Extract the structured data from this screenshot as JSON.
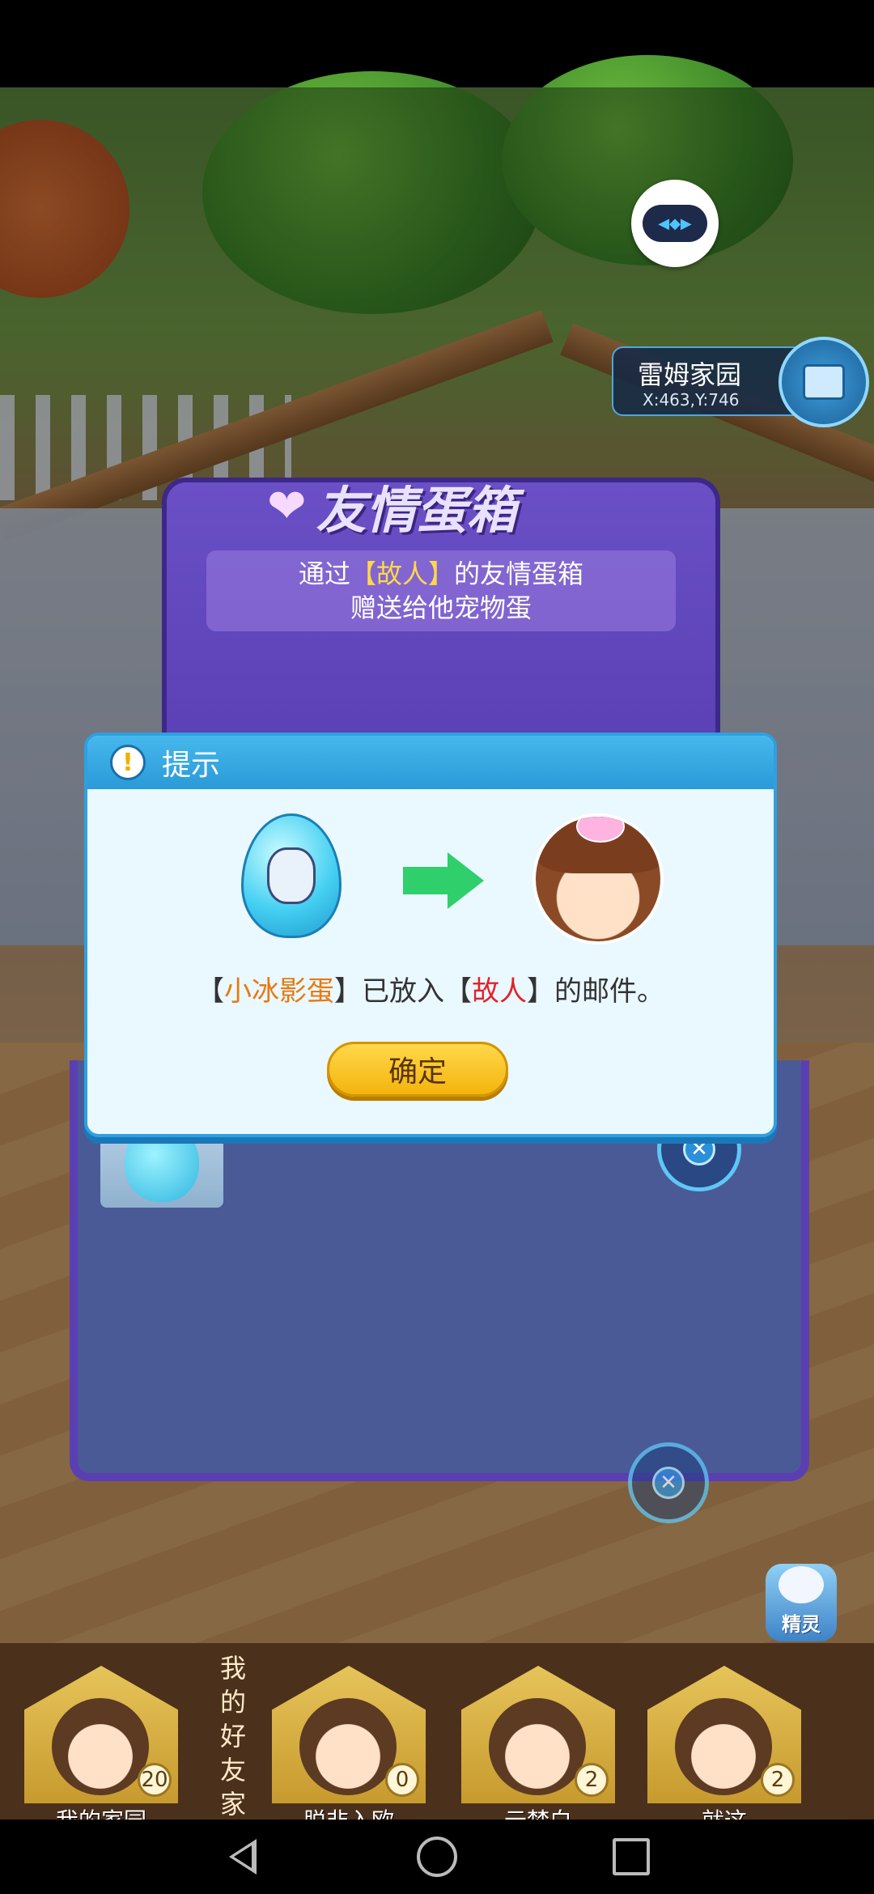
{
  "location": {
    "name": "雷姆家园",
    "coords": "X:463,Y:746"
  },
  "egg_box": {
    "title": "友情蛋箱",
    "subtitle_prefix": "通过",
    "subtitle_name": "【故人】",
    "subtitle_suffix": "的友情蛋箱",
    "subtitle_line2": "赠送给他宠物蛋"
  },
  "dialog": {
    "title": "提示",
    "message": {
      "open1": "【",
      "egg_name": "小冰影蛋",
      "mid": "】已放入【",
      "recipient": "故人",
      "end": "】的邮件。"
    },
    "confirm_label": "确定"
  },
  "sprite_button_label": "精灵",
  "friends_section_label": "我的好友家园",
  "homes": [
    {
      "name": "我的家园",
      "count": "20"
    },
    {
      "name": "脱非入欧",
      "count": "0"
    },
    {
      "name": "云梦白",
      "count": "2"
    },
    {
      "name": "就这",
      "count": "2"
    }
  ],
  "colors": {
    "accent_blue": "#2ea0e0",
    "confirm_yellow": "#f4b40e",
    "highlight_orange": "#e67a12",
    "highlight_red": "#e0222a"
  }
}
